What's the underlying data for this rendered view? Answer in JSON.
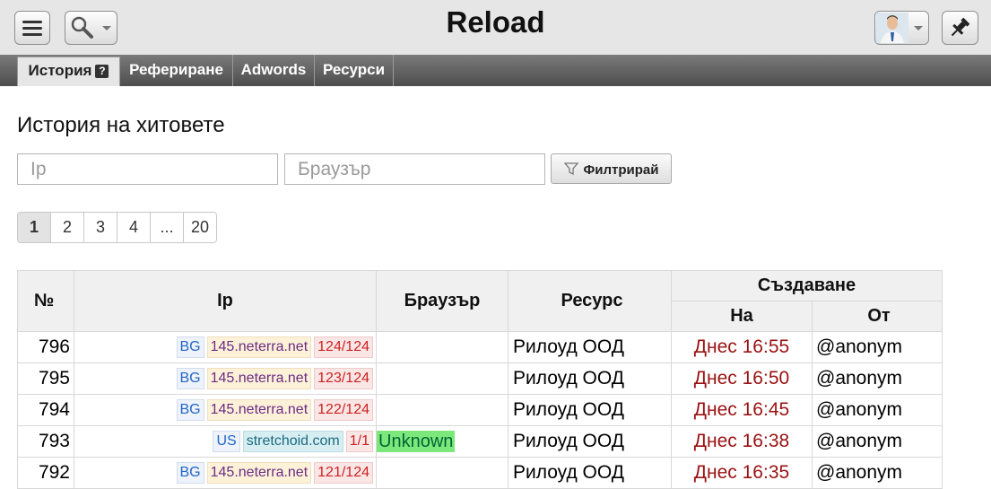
{
  "app": {
    "title": "Reload"
  },
  "icons": {
    "menu": "menu-icon",
    "search": "search-icon",
    "avatar": "user-avatar-icon",
    "pin": "pin-icon",
    "help": "help-icon",
    "filter": "funnel-icon"
  },
  "tabs": [
    {
      "label": "История",
      "active": true
    },
    {
      "label": "Рефериране",
      "active": false
    },
    {
      "label": "Adwords",
      "active": false
    },
    {
      "label": "Ресурси",
      "active": false
    }
  ],
  "page": {
    "title": "История на хитовете"
  },
  "filters": {
    "ip_placeholder": "Ip",
    "ip_value": "",
    "browser_placeholder": "Браузър",
    "browser_value": "",
    "filter_button": "Филтрирай"
  },
  "pagination": {
    "current": 1,
    "items": [
      "1",
      "2",
      "3",
      "4",
      "...",
      "20"
    ]
  },
  "table": {
    "headers": {
      "num": "№",
      "ip": "Ip",
      "browser": "Браузър",
      "resource": "Ресурс",
      "created": "Създаване",
      "on": "На",
      "by": "От"
    },
    "rows": [
      {
        "num": "796",
        "country": "BG",
        "host": "145.neterra.net",
        "count": "124/124",
        "browser": "",
        "resource": "Рилоуд ООД",
        "date": "Днес 16:55",
        "by": "@anonym"
      },
      {
        "num": "795",
        "country": "BG",
        "host": "145.neterra.net",
        "count": "123/124",
        "browser": "",
        "resource": "Рилоуд ООД",
        "date": "Днес 16:50",
        "by": "@anonym"
      },
      {
        "num": "794",
        "country": "BG",
        "host": "145.neterra.net",
        "count": "122/124",
        "browser": "",
        "resource": "Рилоуд ООД",
        "date": "Днес 16:45",
        "by": "@anonym"
      },
      {
        "num": "793",
        "country": "US",
        "host": "stretchoid.com",
        "count": "1/1",
        "browser": "Unknown",
        "resource": "Рилоуд ООД",
        "date": "Днес 16:38",
        "by": "@anonym"
      },
      {
        "num": "792",
        "country": "BG",
        "host": "145.neterra.net",
        "count": "121/124",
        "browser": "",
        "resource": "Рилоуд ООД",
        "date": "Днес 16:35",
        "by": "@anonym"
      }
    ]
  },
  "colors": {
    "topbar_bg": "#e6e6e6",
    "tabbar_bg": "#5f5f5f",
    "date_text": "#9a1212",
    "browser_highlight": "#7ce87c"
  }
}
